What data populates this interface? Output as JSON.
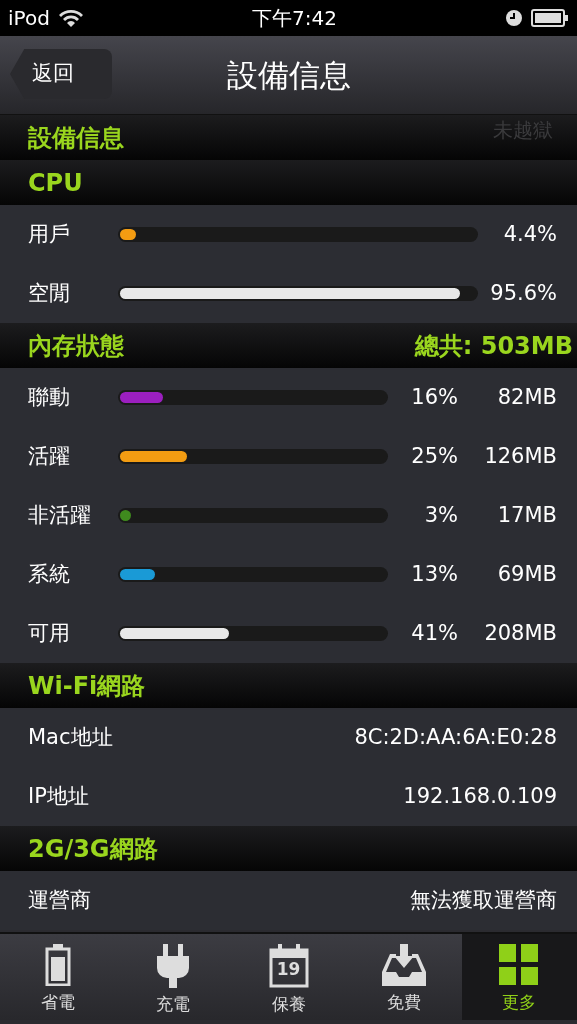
{
  "status_bar": {
    "device": "iPod",
    "time": "下午7:42"
  },
  "nav": {
    "back": "返回",
    "title": "設備信息"
  },
  "device_section": {
    "title": "設備信息",
    "hidden_row_value": "未越獄"
  },
  "cpu": {
    "title": "CPU",
    "rows": [
      {
        "label": "用戶",
        "level": 0.044,
        "reading": "4.4%",
        "color": "#f39c12"
      },
      {
        "label": "空閒",
        "level": 0.956,
        "reading": "95.6%",
        "color": "#e8e8e8"
      }
    ]
  },
  "memory": {
    "title": "內存狀態",
    "total": "總共: 503MB",
    "rows": [
      {
        "label": "聯動",
        "level": 0.16,
        "percent": "16%",
        "size": "82MB",
        "color": "#9b1fbf"
      },
      {
        "label": "活躍",
        "level": 0.25,
        "percent": "25%",
        "size": "126MB",
        "color": "#f39c12"
      },
      {
        "label": "非活躍",
        "level": 0.03,
        "percent": "3%",
        "size": "17MB",
        "color": "#3f8a1e"
      },
      {
        "label": "系統",
        "level": 0.13,
        "percent": "13%",
        "size": "69MB",
        "color": "#1a9ad6"
      },
      {
        "label": "可用",
        "level": 0.41,
        "percent": "41%",
        "size": "208MB",
        "color": "#e8e8e8"
      }
    ]
  },
  "wifi": {
    "title": "Wi-Fi網路",
    "rows": [
      {
        "label": "Mac地址",
        "value": "8C:2D:AA:6A:E0:28"
      },
      {
        "label": "IP地址",
        "value": "192.168.0.109"
      }
    ]
  },
  "cellular": {
    "title": "2G/3G網路",
    "rows": [
      {
        "label": "運營商",
        "value": "無法獲取運營商"
      }
    ]
  },
  "tab_bar": [
    {
      "label": "省電",
      "kind": "battery",
      "selected": false
    },
    {
      "label": "充電",
      "kind": "plug",
      "selected": false
    },
    {
      "label": "保養",
      "kind": "calendar",
      "day": "19",
      "selected": false
    },
    {
      "label": "免費",
      "kind": "inbox",
      "selected": false
    },
    {
      "label": "更多",
      "kind": "grid",
      "selected": true
    }
  ]
}
